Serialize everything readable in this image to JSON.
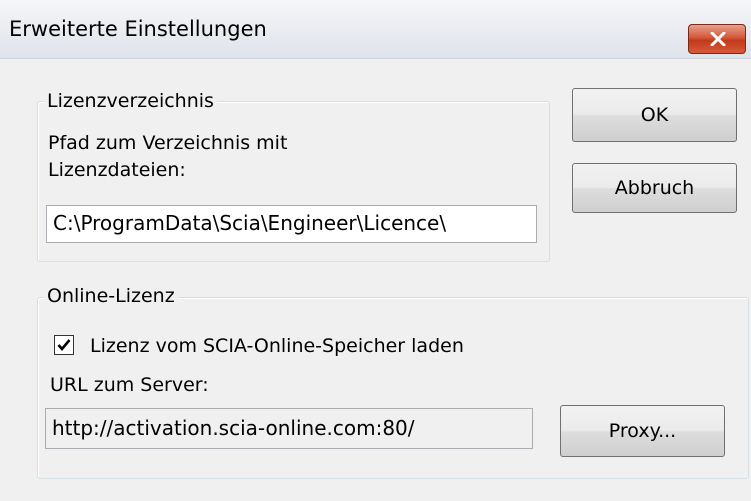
{
  "window": {
    "title": "Erweiterte Einstellungen",
    "close_icon": "close-icon"
  },
  "license_directory": {
    "group_title": "Lizenzverzeichnis",
    "path_label_line1": "Pfad zum Verzeichnis mit",
    "path_label_line2": "Lizenzdateien:",
    "path_value": "C:\\ProgramData\\Scia\\Engineer\\Licence\\"
  },
  "online_license": {
    "group_title": "Online-Lizenz",
    "checkbox_label": "Lizenz vom SCIA-Online-Speicher laden",
    "checkbox_checked": true,
    "url_label": "URL zum Server:",
    "url_value": "http://activation.scia-online.com:80/"
  },
  "buttons": {
    "ok": "OK",
    "cancel": "Abbruch",
    "proxy": "Proxy..."
  },
  "colors": {
    "close_button": "#c8472a",
    "dialog_background": "#f0f0f0"
  }
}
